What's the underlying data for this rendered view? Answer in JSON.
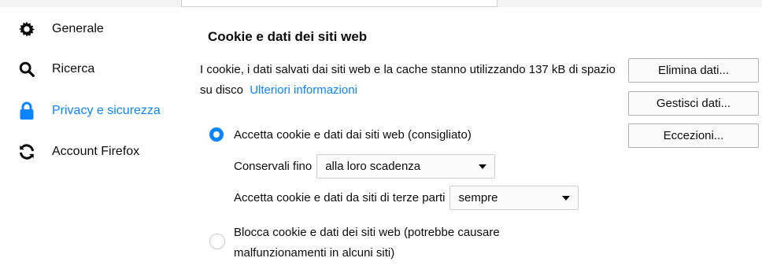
{
  "sidebar": {
    "items": [
      {
        "label": "Generale",
        "icon": "gear-icon"
      },
      {
        "label": "Ricerca",
        "icon": "search-icon"
      },
      {
        "label": "Privacy e sicurezza",
        "icon": "lock-icon",
        "selected": true
      },
      {
        "label": "Account Firefox",
        "icon": "sync-icon"
      }
    ]
  },
  "cookies": {
    "title": "Cookie e dati dei siti web",
    "description": "I cookie, i dati salvati dai siti web e la cache stanno utilizzando 137 kB di spazio su disco",
    "learn_more": "Ulteriori informazioni",
    "buttons": {
      "clear_data": "Elimina dati...",
      "manage_data": "Gestisci dati...",
      "exceptions": "Eccezioni..."
    },
    "accept_option": {
      "label": "Accetta cookie e dati dai siti web (consigliato)",
      "checked": true
    },
    "keep_until": {
      "label": "Conservali fino",
      "value": "alla loro scadenza"
    },
    "third_party": {
      "label": "Accetta cookie e dati da siti di terze parti",
      "value": "sempre"
    },
    "block_option": {
      "label": "Blocca cookie e dati dei siti web (potrebbe causare malfunzionamenti in alcuni siti)",
      "checked": false
    }
  },
  "colors": {
    "accent": "#0a84ff",
    "text": "#0c0c0d"
  }
}
